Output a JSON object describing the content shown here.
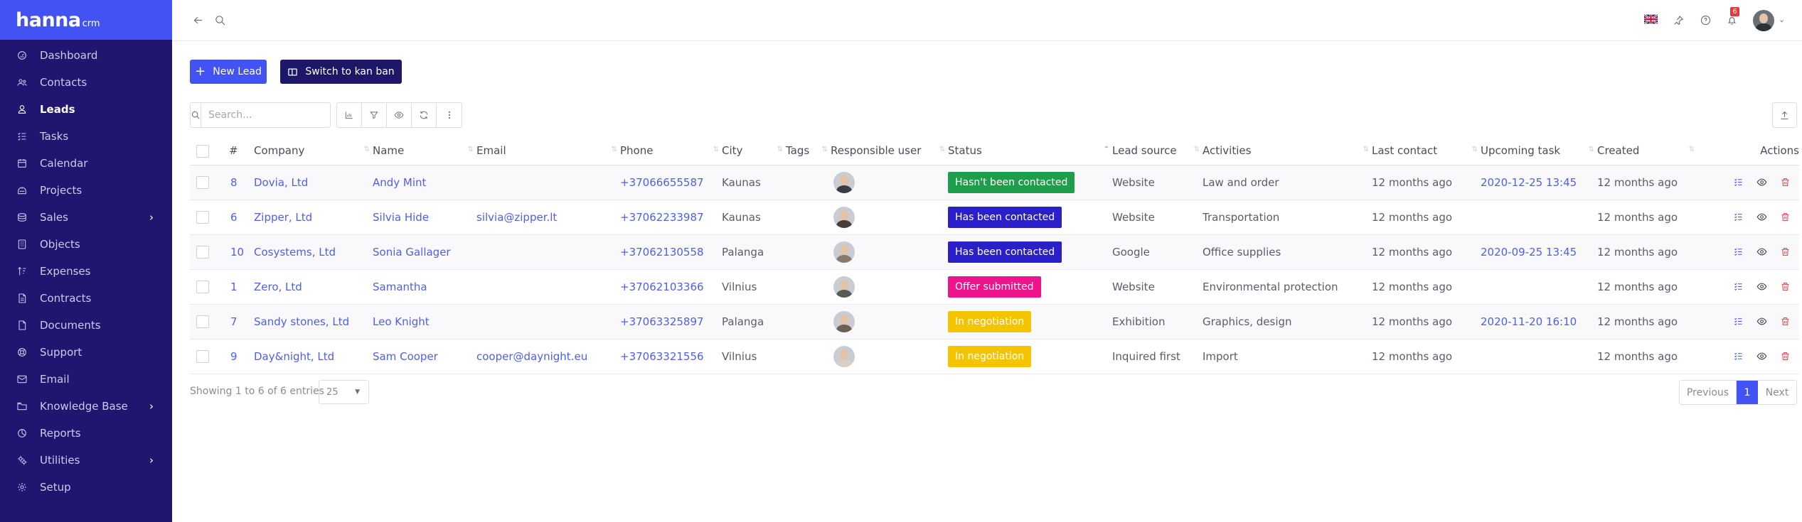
{
  "brand": {
    "main": "hanna",
    "sub": "crm"
  },
  "sidebar": {
    "items": [
      {
        "label": "Dashboard",
        "icon": "dashboard-icon"
      },
      {
        "label": "Contacts",
        "icon": "contacts-icon"
      },
      {
        "label": "Leads",
        "icon": "leads-icon",
        "active": true
      },
      {
        "label": "Tasks",
        "icon": "tasks-icon"
      },
      {
        "label": "Calendar",
        "icon": "calendar-icon"
      },
      {
        "label": "Projects",
        "icon": "projects-icon"
      },
      {
        "label": "Sales",
        "icon": "sales-icon",
        "submenu": true
      },
      {
        "label": "Objects",
        "icon": "objects-icon"
      },
      {
        "label": "Expenses",
        "icon": "expenses-icon"
      },
      {
        "label": "Contracts",
        "icon": "contracts-icon"
      },
      {
        "label": "Documents",
        "icon": "documents-icon"
      },
      {
        "label": "Support",
        "icon": "support-icon"
      },
      {
        "label": "Email",
        "icon": "email-icon"
      },
      {
        "label": "Knowledge Base",
        "icon": "knowledge-base-icon",
        "submenu": true
      },
      {
        "label": "Reports",
        "icon": "reports-icon"
      },
      {
        "label": "Utilities",
        "icon": "utilities-icon",
        "submenu": true
      },
      {
        "label": "Setup",
        "icon": "setup-icon"
      }
    ]
  },
  "topbar": {
    "notification_count": "6"
  },
  "buttons": {
    "new_lead": "New Lead",
    "switch_kanban": "Switch to kan ban"
  },
  "search": {
    "placeholder": "Search..."
  },
  "table": {
    "columns": [
      "",
      "#",
      "Company",
      "Name",
      "Email",
      "Phone",
      "City",
      "Tags",
      "Responsible user",
      "Status",
      "Lead source",
      "Activities",
      "Last contact",
      "Upcoming task",
      "Created",
      "Actions"
    ],
    "rows": [
      {
        "id": "8",
        "company": "Dovia, Ltd",
        "name": "Andy Mint",
        "email": "",
        "phone": "+37066655587",
        "city": "Kaunas",
        "tags": "",
        "status": "Hasn't been contacted",
        "status_color": "#1e9e4a",
        "source": "Website",
        "activities": "Law and order",
        "last_contact": "12 months ago",
        "upcoming_task": "2020-12-25 13:45",
        "created": "12 months ago",
        "avatar_color": "#3a3d44"
      },
      {
        "id": "6",
        "company": "Zipper, Ltd",
        "name": "Silvia Hide",
        "email": "silvia@zipper.lt",
        "phone": "+37062233987",
        "city": "Kaunas",
        "tags": "",
        "status": "Has been contacted",
        "status_color": "#2a1fc9",
        "source": "Website",
        "activities": "Transportation",
        "last_contact": "12 months ago",
        "upcoming_task": "",
        "created": "12 months ago",
        "avatar_color": "#4a3f38"
      },
      {
        "id": "10",
        "company": "Cosystems, Ltd",
        "name": "Sonia Gallager",
        "email": "",
        "phone": "+37062130558",
        "city": "Palanga",
        "tags": "",
        "status": "Has been contacted",
        "status_color": "#2a1fc9",
        "source": "Google",
        "activities": "Office supplies",
        "last_contact": "12 months ago",
        "upcoming_task": "2020-09-25 13:45",
        "created": "12 months ago",
        "avatar_color": "#8a7a6e"
      },
      {
        "id": "1",
        "company": "Zero, Ltd",
        "name": "Samantha",
        "email": "",
        "phone": "+37062103366",
        "city": "Vilnius",
        "tags": "",
        "status": "Offer submitted",
        "status_color": "#f0148c",
        "source": "Website",
        "activities": "Environmental protection",
        "last_contact": "12 months ago",
        "upcoming_task": "",
        "created": "12 months ago",
        "avatar_color": "#555a52"
      },
      {
        "id": "7",
        "company": "Sandy stones, Ltd",
        "name": "Leo Knight",
        "email": "",
        "phone": "+37063325897",
        "city": "Palanga",
        "tags": "",
        "status": "In negotiation",
        "status_color": "#f5c400",
        "source": "Exhibition",
        "activities": "Graphics, design",
        "last_contact": "12 months ago",
        "upcoming_task": "2020-11-20 16:10",
        "created": "12 months ago",
        "avatar_color": "#6e5f55"
      },
      {
        "id": "9",
        "company": "Day&night, Ltd",
        "name": "Sam Cooper",
        "email": "cooper@daynight.eu",
        "phone": "+37063321556",
        "city": "Vilnius",
        "tags": "",
        "status": "In negotiation",
        "status_color": "#f5c400",
        "source": "Inquired first",
        "activities": "Import",
        "last_contact": "12 months ago",
        "upcoming_task": "",
        "created": "12 months ago",
        "avatar_color": "#d9cfc7"
      }
    ]
  },
  "footer": {
    "showing": "Showing 1 to 6 of 6 entries",
    "per_page": "25",
    "pagination": {
      "previous": "Previous",
      "current": "1",
      "next": "Next"
    }
  }
}
